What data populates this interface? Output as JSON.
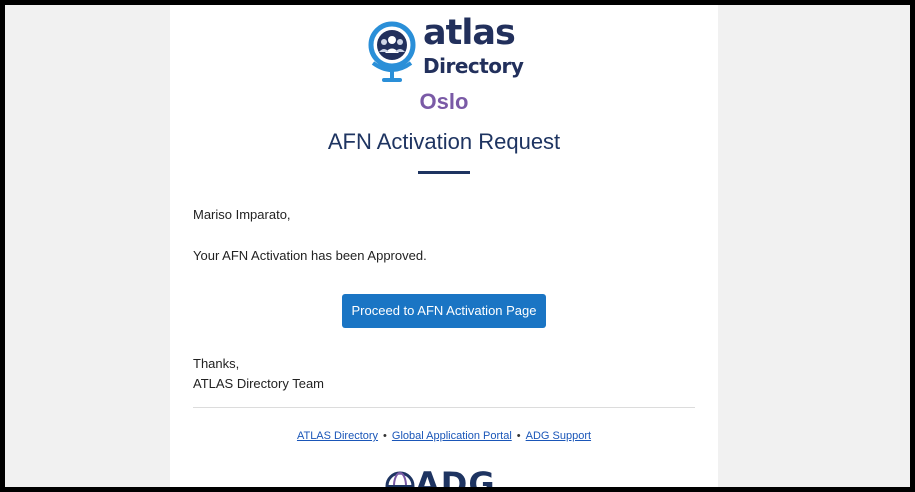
{
  "header": {
    "logo_word": "atlas",
    "logo_sub": "Directory",
    "city": "Oslo",
    "title": "AFN Activation Request"
  },
  "body": {
    "greeting": "Mariso Imparato,",
    "message": "Your AFN Activation has been Approved.",
    "button_label": "Proceed to AFN Activation Page",
    "thanks": "Thanks,",
    "signature": "ATLAS Directory Team"
  },
  "footer": {
    "links": [
      "ATLAS Directory",
      "Global Application Portal",
      "ADG Support"
    ],
    "separator": "•",
    "logo_text": "ADG"
  },
  "colors": {
    "brand_navy": "#1e3461",
    "city_purple": "#7a5aa6",
    "button_blue": "#1a75c4",
    "link_blue": "#1a56b8",
    "logo_accent_blue": "#2a8fd8"
  }
}
